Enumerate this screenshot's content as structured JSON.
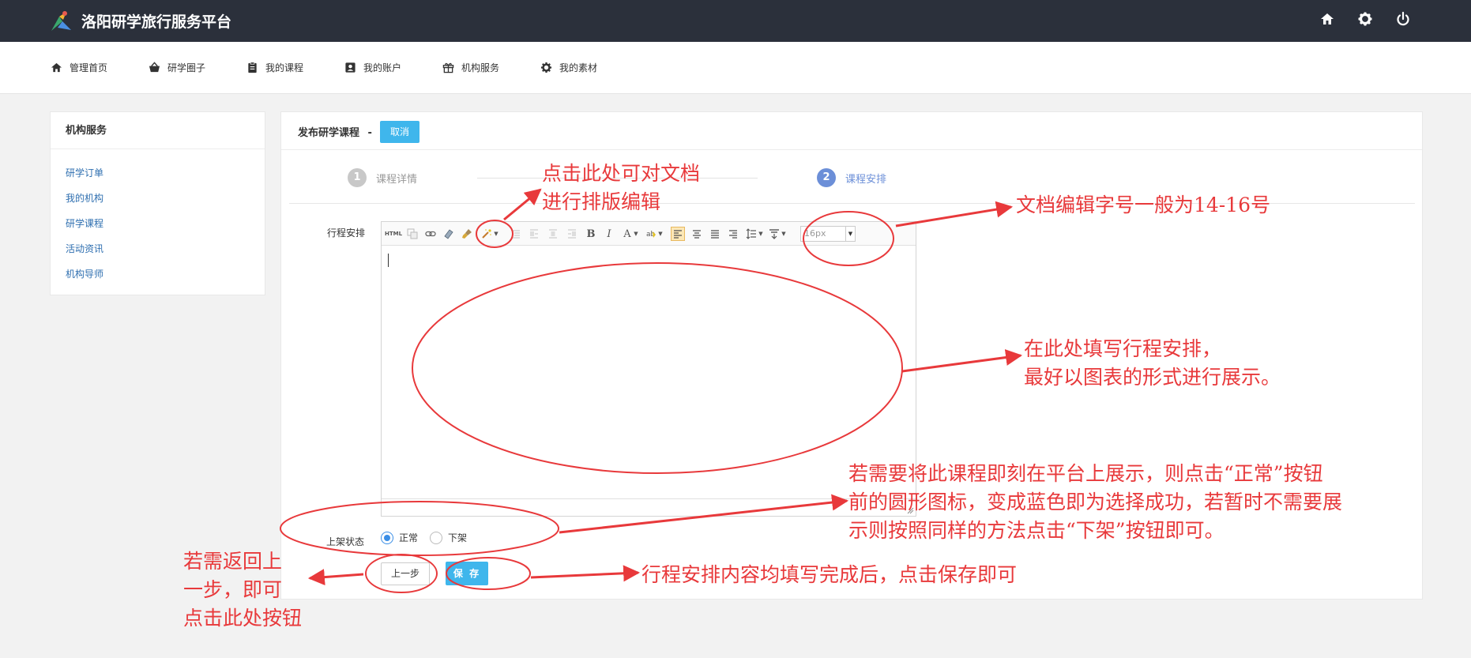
{
  "app": {
    "title": "洛阳研学旅行服务平台",
    "top_icons": [
      "home-icon",
      "gear-icon",
      "power-icon"
    ]
  },
  "nav": {
    "items": [
      {
        "label": "管理首页",
        "icon": "home-icon"
      },
      {
        "label": "研学圈子",
        "icon": "basket-icon"
      },
      {
        "label": "我的课程",
        "icon": "clipboard-icon"
      },
      {
        "label": "我的账户",
        "icon": "user-card-icon"
      },
      {
        "label": "机构服务",
        "icon": "gift-icon"
      },
      {
        "label": "我的素材",
        "icon": "gear-icon"
      }
    ]
  },
  "sidebar": {
    "title": "机构服务",
    "items": [
      {
        "label": "研学订单"
      },
      {
        "label": "我的机构"
      },
      {
        "label": "研学课程"
      },
      {
        "label": "活动资讯"
      },
      {
        "label": "机构导师"
      }
    ]
  },
  "main": {
    "title": "发布研学课程",
    "title_sep": "-",
    "cancel_label": "取消",
    "steps": [
      {
        "num": "1",
        "label": "课程详情",
        "state": "done"
      },
      {
        "num": "2",
        "label": "课程安排",
        "state": "current"
      }
    ],
    "schedule_label": "行程安排",
    "editor": {
      "font_size": "16px",
      "toolbar": [
        "html-icon",
        "copy-format-icon",
        "link-icon",
        "eraser-icon",
        "brush-icon",
        "magic-wand-icon",
        "indent-icon",
        "align-block-left-icon",
        "align-block-center-icon",
        "align-block-right-icon",
        "bold-icon",
        "italic-icon",
        "font-color-icon",
        "highlight-icon",
        "align-left-icon",
        "align-center-icon",
        "align-justify-icon",
        "align-right-icon",
        "line-height-icon",
        "paragraph-spacing-icon"
      ]
    },
    "status": {
      "label": "上架状态",
      "options": [
        {
          "label": "正常",
          "checked": true
        },
        {
          "label": "下架",
          "checked": false
        }
      ]
    },
    "prev_label": "上一步",
    "save_label": "保 存"
  },
  "annotations": {
    "toolbar_note": [
      "点击此处可对文档",
      "进行排版编辑"
    ],
    "fontsize_note": "文档编辑字号一般为14-16号",
    "content_note": [
      "在此处填写行程安排，",
      "最好以图表的形式进行展示。"
    ],
    "status_note": [
      "若需要将此课程即刻在平台上展示，则点击“正常”按钮",
      "前的圆形图标，变成蓝色即为选择成功，若暂时不需要展",
      "示则按照同样的方法点击“下架”按钮即可。"
    ],
    "prev_note": [
      "若需返回上",
      "一步，即可",
      "点击此处按钮"
    ],
    "save_note": "行程安排内容均填写完成后，点击保存即可"
  },
  "colors": {
    "topbar": "#2b303b",
    "accent": "#3fb6ec",
    "step_active": "#6c8fd8",
    "step_done": "#c8c8c8",
    "annotation": "#e8393b"
  }
}
